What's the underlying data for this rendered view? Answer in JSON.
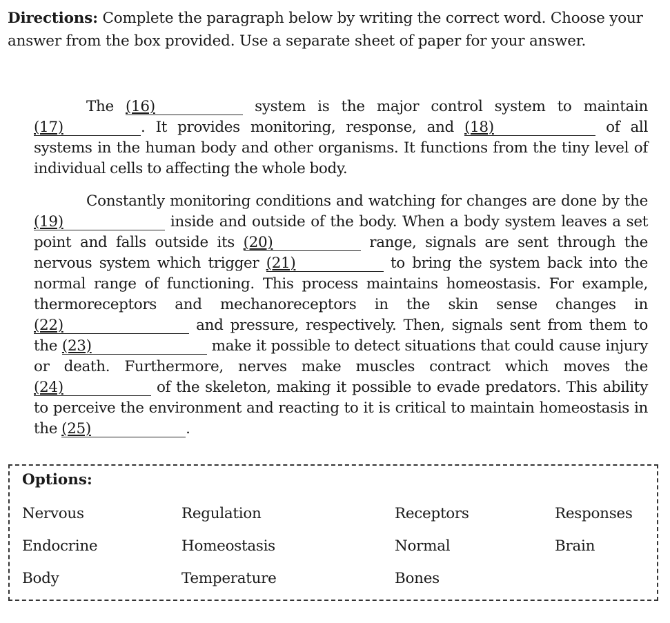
{
  "directions": {
    "lead": "Directions:",
    "text": " Complete the paragraph below by writing the correct word. Choose your answer from the box provided. Use a separate sheet of paper for your answer."
  },
  "paragraph1": {
    "t1": "The ",
    "b16": "(16)",
    "t2": " system is the major control system to maintain ",
    "b17": "(17)",
    "t3": ". It provides monitoring, response, and ",
    "b18": "(18)",
    "t4": " of all systems in the human body and other organisms. It functions from the tiny level of individual cells to affecting the whole body."
  },
  "paragraph2": {
    "t1": "Constantly monitoring conditions and watching for changes are done by the ",
    "b19": "(19)",
    "t2": " inside and outside of the body. When a body system leaves a set point and falls outside its ",
    "b20": "(20)",
    "t3": " range, signals are sent through the nervous system which trigger ",
    "b21": "(21)",
    "t4": " to bring the system back into the normal range of functioning. This process maintains homeostasis. For example, thermoreceptors and mechanoreceptors in the skin sense changes in ",
    "b22": "(22)",
    "t5": " and pressure, respectively. Then, signals sent from them to the ",
    "b23": "(23)",
    "t6": " make it possible to detect situations that could cause injury or death. Furthermore, nerves make muscles contract which moves the ",
    "b24": "(24)",
    "t7": " of the skeleton, making it possible to evade predators. This ability to perceive the environment and reacting to it is critical to maintain homeostasis in the ",
    "b25": "(25)",
    "t8": "."
  },
  "options": {
    "title": "Options:",
    "rows": [
      [
        "Nervous",
        "Regulation",
        "Receptors",
        "Responses"
      ],
      [
        "Endocrine",
        "Homeostasis",
        "Normal",
        "Brain"
      ],
      [
        "Body",
        "Temperature",
        "Bones",
        ""
      ]
    ]
  }
}
